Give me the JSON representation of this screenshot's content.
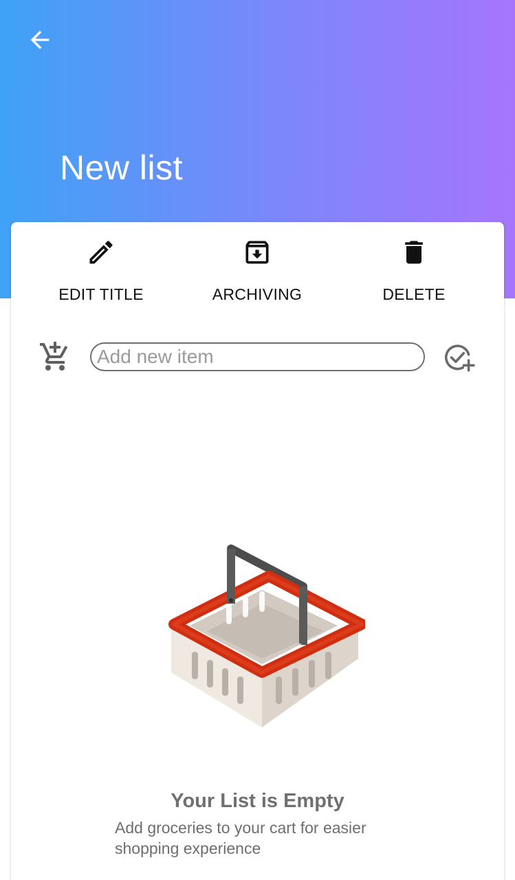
{
  "header": {
    "title": "New list",
    "back_icon": "arrow-left-icon",
    "gradient_start": "#3fa2f6",
    "gradient_end": "#a775fd"
  },
  "actions": [
    {
      "label": "EDIT TITLE",
      "icon": "pencil-icon"
    },
    {
      "label": "ARCHIVING",
      "icon": "archive-icon"
    },
    {
      "label": "DELETE",
      "icon": "trash-icon"
    }
  ],
  "add_item": {
    "placeholder": "Add new item",
    "value": "",
    "cart_icon": "add-to-cart-icon",
    "confirm_icon": "check-add-icon"
  },
  "empty_state": {
    "illustration": "shopping-basket-illustration",
    "title": "Your List is Empty",
    "subtitle": "Add groceries to your cart for easier shopping experience"
  }
}
